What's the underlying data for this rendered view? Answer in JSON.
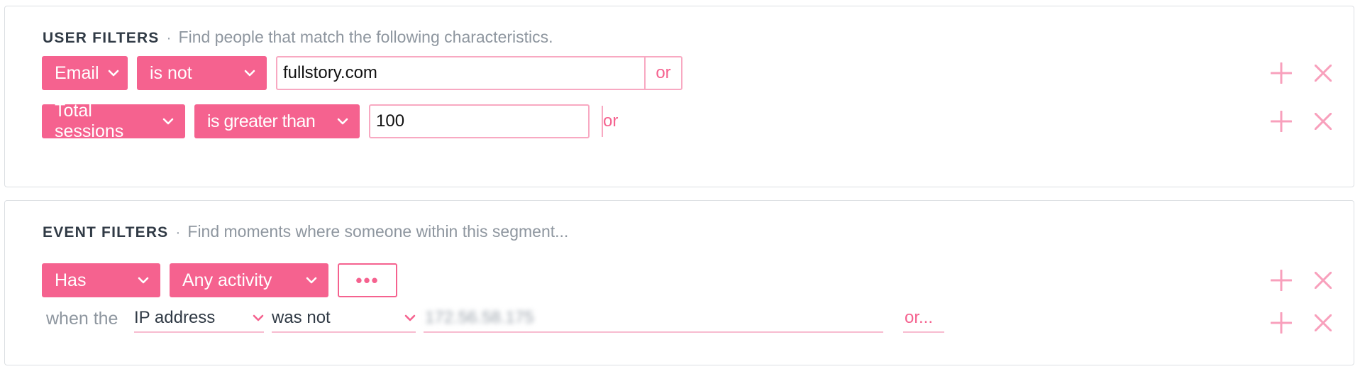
{
  "user_filters": {
    "title": "USER FILTERS",
    "separator": "·",
    "description": "Find people that match the following characteristics.",
    "rows": [
      {
        "field": "Email",
        "operator": "is not",
        "value": "fullstory.com",
        "or_label": "or"
      },
      {
        "field": "Total sessions",
        "operator": "is greater than",
        "value": "100",
        "or_label": "or"
      }
    ]
  },
  "event_filters": {
    "title": "EVENT FILTERS",
    "separator": "·",
    "description": "Find moments where someone within this segment...",
    "main": {
      "verb": "Has",
      "event": "Any activity",
      "more_label": "•••"
    },
    "sub": {
      "prefix": "when the",
      "property": "IP address",
      "operator": "was not",
      "value": "172.56.58.175",
      "or_label": "or..."
    }
  },
  "icons": {
    "add": "plus-icon",
    "remove": "close-icon",
    "dropdown": "chevron-down-icon"
  },
  "colors": {
    "accent": "#f5628f",
    "accent_light": "#f8a9c2",
    "heading": "#303a45",
    "muted": "#8e969f",
    "border": "#dcdfe3"
  }
}
